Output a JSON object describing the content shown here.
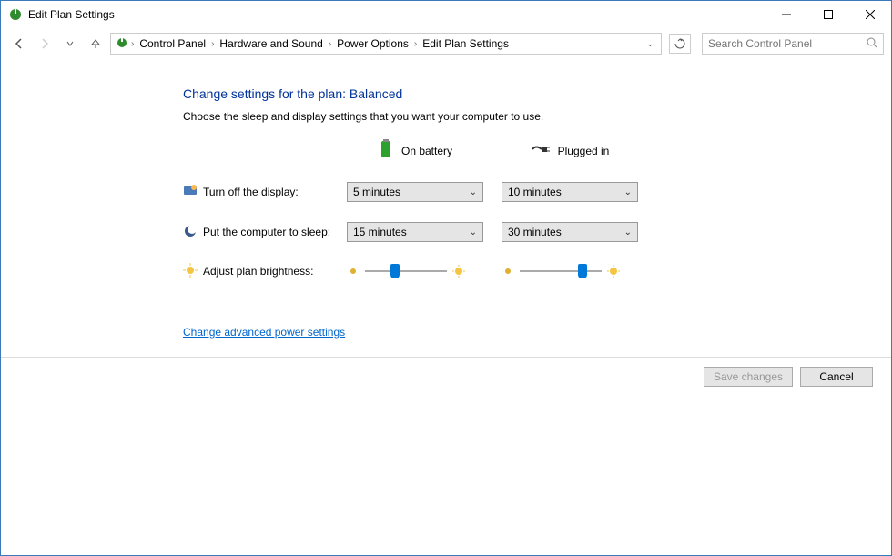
{
  "window": {
    "title": "Edit Plan Settings"
  },
  "breadcrumb": {
    "items": [
      "Control Panel",
      "Hardware and Sound",
      "Power Options",
      "Edit Plan Settings"
    ]
  },
  "search": {
    "placeholder": "Search Control Panel"
  },
  "page": {
    "heading": "Change settings for the plan: Balanced",
    "subtext": "Choose the sleep and display settings that you want your computer to use.",
    "col_battery": "On battery",
    "col_plugged": "Plugged in",
    "row_display": "Turn off the display:",
    "row_sleep": "Put the computer to sleep:",
    "row_brightness": "Adjust plan brightness:",
    "display_battery": "5 minutes",
    "display_plugged": "10 minutes",
    "sleep_battery": "15 minutes",
    "sleep_plugged": "30 minutes",
    "brightness_battery_pct": 35,
    "brightness_plugged_pct": 80,
    "advanced_link": "Change advanced power settings",
    "save_btn": "Save changes",
    "cancel_btn": "Cancel"
  }
}
